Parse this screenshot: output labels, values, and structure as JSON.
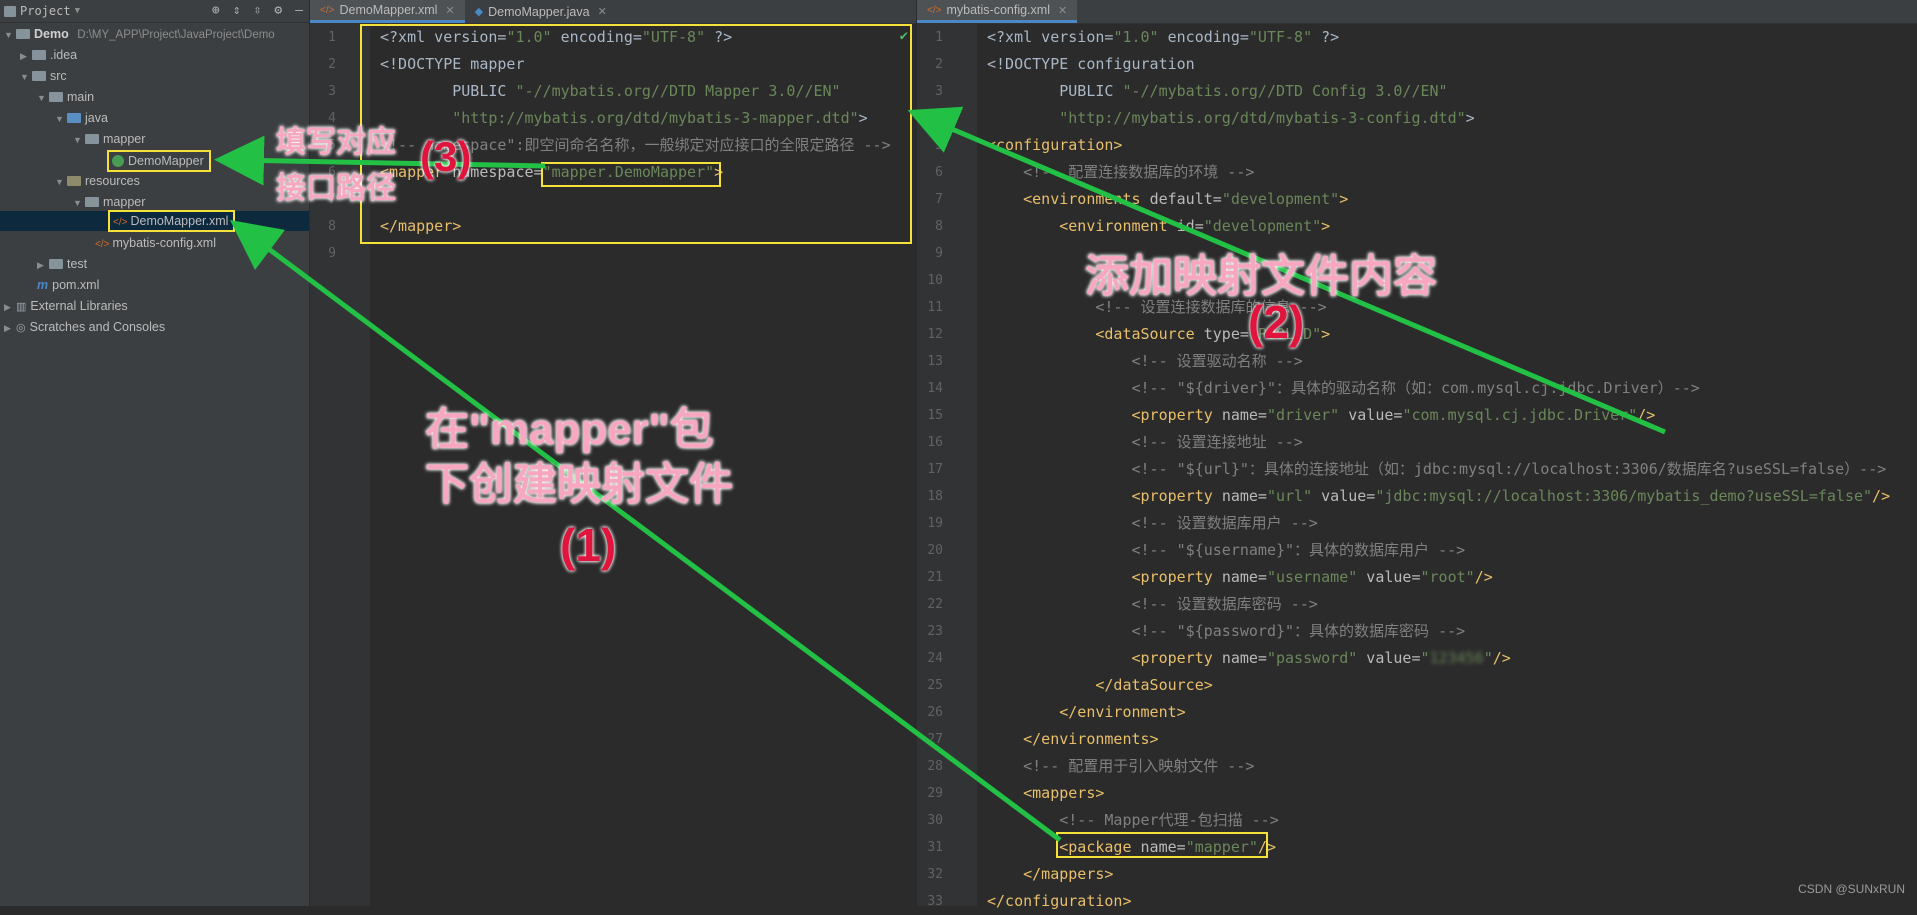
{
  "project_panel": {
    "title": "Project",
    "tree": [
      {
        "label": "Demo",
        "path": "D:\\MY_APP\\Project\\JavaProject\\Demo"
      },
      {
        "label": ".idea"
      },
      {
        "label": "src"
      },
      {
        "label": "main"
      },
      {
        "label": "java"
      },
      {
        "label": "mapper"
      },
      {
        "label": "DemoMapper"
      },
      {
        "label": "resources"
      },
      {
        "label": "mapper"
      },
      {
        "label": "DemoMapper.xml"
      },
      {
        "label": "mybatis-config.xml"
      },
      {
        "label": "test"
      },
      {
        "label": "pom.xml"
      },
      {
        "label": "External Libraries"
      },
      {
        "label": "Scratches and Consoles"
      }
    ]
  },
  "left_editor": {
    "tabs": [
      "DemoMapper.xml",
      "DemoMapper.java"
    ],
    "lines": [
      {
        "n": "1",
        "html": "<span class=\"w\">&lt;?xml version=</span><span class=\"s\">\"1.0\"</span><span class=\"w\"> encoding=</span><span class=\"s\">\"UTF-8\"</span><span class=\"w\"> ?&gt;</span>"
      },
      {
        "n": "2",
        "html": "<span class=\"w\">&lt;!DOCTYPE mapper</span>"
      },
      {
        "n": "3",
        "html": "        <span class=\"w\">PUBLIC </span><span class=\"s\">\"-//mybatis.org//DTD Mapper 3.0//EN\"</span>"
      },
      {
        "n": "4",
        "html": "        <span class=\"s\">\"http://mybatis.org/dtd/mybatis-3-mapper.dtd\"</span><span class=\"w\">&gt;</span>"
      },
      {
        "n": "5",
        "html": "<span class=\"c\">&lt;!-- namespace\":即空间命名名称，一般绑定对应接口的全限定路径 --&gt;</span>"
      },
      {
        "n": "6",
        "html": "<span class=\"t\">&lt;mapper </span><span class=\"a\">namespace=</span><span class=\"s\">\"mapper.DemoMapper\"</span><span class=\"t\">&gt;</span>"
      },
      {
        "n": "7",
        "html": ""
      },
      {
        "n": "8",
        "html": "<span class=\"t\">&lt;/mapper&gt;</span>"
      },
      {
        "n": "9",
        "html": ""
      }
    ]
  },
  "right_editor": {
    "tabs": [
      "mybatis-config.xml"
    ],
    "lines": [
      {
        "n": "1",
        "html": "<span class=\"w\">&lt;?xml version=</span><span class=\"s\">\"1.0\"</span><span class=\"w\"> encoding=</span><span class=\"s\">\"UTF-8\"</span><span class=\"w\"> ?&gt;</span>"
      },
      {
        "n": "2",
        "html": "<span class=\"w\">&lt;!DOCTYPE configuration</span>"
      },
      {
        "n": "3",
        "html": "        <span class=\"w\">PUBLIC </span><span class=\"s\">\"-//mybatis.org//DTD Config 3.0//EN\"</span>"
      },
      {
        "n": "4",
        "html": "        <span class=\"s\">\"http://mybatis.org/dtd/mybatis-3-config.dtd\"</span><span class=\"w\">&gt;</span>"
      },
      {
        "n": "5",
        "html": "<span class=\"t\">&lt;configuration&gt;</span>"
      },
      {
        "n": "6",
        "html": "    <span class=\"c\">&lt;!-- 配置连接数据库的环境 --&gt;</span>"
      },
      {
        "n": "7",
        "html": "    <span class=\"t\">&lt;environments </span><span class=\"a\">default=</span><span class=\"s\">\"development\"</span><span class=\"t\">&gt;</span>"
      },
      {
        "n": "8",
        "html": "        <span class=\"t\">&lt;environment </span><span class=\"a\">id=</span><span class=\"s\">\"development\"</span><span class=\"t\">&gt;</span>"
      },
      {
        "n": "9",
        "html": ""
      },
      {
        "n": "10",
        "html": ""
      },
      {
        "n": "11",
        "html": "            <span class=\"c\">&lt;!-- 设置连接数据库的信息 --&gt;</span>"
      },
      {
        "n": "12",
        "html": "            <span class=\"t\">&lt;dataSource </span><span class=\"a\">type=</span><span class=\"s\">\"POOLED\"</span><span class=\"t\">&gt;</span>"
      },
      {
        "n": "13",
        "html": "                <span class=\"c\">&lt;!-- 设置驱动名称 --&gt;</span>"
      },
      {
        "n": "14",
        "html": "                <span class=\"c\">&lt;!-- \"${driver}\"：具体的驱动名称（如：com.mysql.cj.jdbc.Driver）--&gt;</span>"
      },
      {
        "n": "15",
        "html": "                <span class=\"t\">&lt;property </span><span class=\"a\">name=</span><span class=\"s\">\"driver\"</span><span class=\"a\"> value=</span><span class=\"s\">\"com.mysql.cj.jdbc.Driver\"</span><span class=\"t\">/&gt;</span>"
      },
      {
        "n": "16",
        "html": "                <span class=\"c\">&lt;!-- 设置连接地址 --&gt;</span>"
      },
      {
        "n": "17",
        "html": "                <span class=\"c\">&lt;!-- \"${url}\"：具体的连接地址（如：jdbc:mysql://localhost:3306/数据库名?useSSL=false）--&gt;</span>"
      },
      {
        "n": "18",
        "html": "                <span class=\"t\">&lt;property </span><span class=\"a\">name=</span><span class=\"s\">\"url\"</span><span class=\"a\"> value=</span><span class=\"s\">\"jdbc:mysql://localhost:3306/mybatis_demo?useSSL=false\"</span><span class=\"t\">/&gt;</span>"
      },
      {
        "n": "19",
        "html": "                <span class=\"c\">&lt;!-- 设置数据库用户 --&gt;</span>"
      },
      {
        "n": "20",
        "html": "                <span class=\"c\">&lt;!-- \"${username}\"：具体的数据库用户 --&gt;</span>"
      },
      {
        "n": "21",
        "html": "                <span class=\"t\">&lt;property </span><span class=\"a\">name=</span><span class=\"s\">\"username\"</span><span class=\"a\"> value=</span><span class=\"s\">\"root\"</span><span class=\"t\">/&gt;</span>"
      },
      {
        "n": "22",
        "html": "                <span class=\"c\">&lt;!-- 设置数据库密码 --&gt;</span>"
      },
      {
        "n": "23",
        "html": "                <span class=\"c\">&lt;!-- \"${password}\"：具体的数据库密码 --&gt;</span>"
      },
      {
        "n": "24",
        "html": "                <span class=\"t\">&lt;property </span><span class=\"a\">name=</span><span class=\"s\">\"password\"</span><span class=\"a\"> value=</span><span class=\"s\">\"<span style='filter:blur(2px)'>123456</span>\"</span><span class=\"t\">/&gt;</span>"
      },
      {
        "n": "25",
        "html": "            <span class=\"t\">&lt;/dataSource&gt;</span>"
      },
      {
        "n": "26",
        "html": "        <span class=\"t\">&lt;/environment&gt;</span>"
      },
      {
        "n": "27",
        "html": "    <span class=\"t\">&lt;/environments&gt;</span>"
      },
      {
        "n": "28",
        "html": "    <span class=\"c\">&lt;!-- 配置用于引入映射文件 --&gt;</span>"
      },
      {
        "n": "29",
        "html": "    <span class=\"t\">&lt;mappers&gt;</span>"
      },
      {
        "n": "30",
        "html": "        <span class=\"c\">&lt;!-- Mapper代理-包扫描 --&gt;</span>"
      },
      {
        "n": "31",
        "html": "        <span class=\"t\">&lt;package </span><span class=\"a\">name=</span><span class=\"s\">\"mapper\"</span><span class=\"t\">/&gt;</span>"
      },
      {
        "n": "32",
        "html": "    <span class=\"t\">&lt;/mappers&gt;</span>"
      },
      {
        "n": "33",
        "html": "<span class=\"t\">&lt;/configuration&gt;</span>"
      }
    ]
  },
  "annotations": {
    "step1_text_a": "在\"mapper\"包",
    "step1_text_b": "下创建映射文件",
    "step1_num": "(1)",
    "step2_text": "添加映射文件内容",
    "step2_num": "(2)",
    "step3_text_a": "填写对应",
    "step3_text_b": "接口路径",
    "step3_num": "(3)"
  },
  "watermark": "CSDN @SUNxRUN",
  "colors": {
    "arrow": "#22c145",
    "highlight_box": "#f5e13a"
  }
}
